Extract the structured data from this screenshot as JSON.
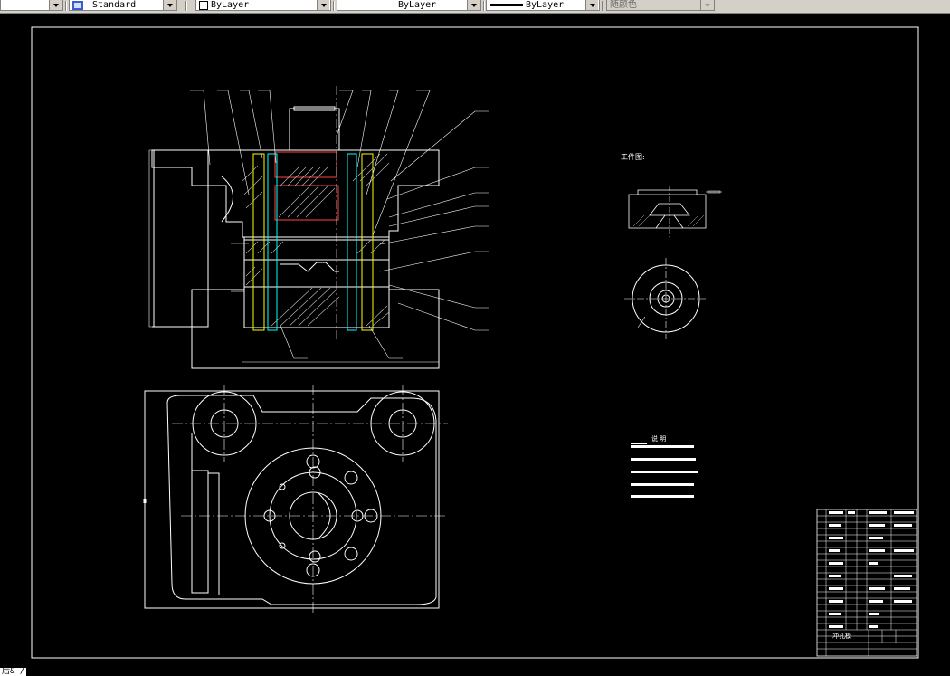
{
  "toolbar": {
    "text_style": "Standard",
    "layer_color": "ByLayer",
    "linetype": "ByLayer",
    "lineweight": "ByLayer",
    "plot_style": "随颜色"
  },
  "drawing": {
    "workpiece_label": "工件图:",
    "notes_title": "说 明",
    "title_block_name": "冲孔模"
  },
  "command_line": "后& /"
}
